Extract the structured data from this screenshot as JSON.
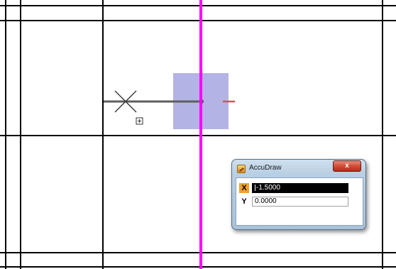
{
  "viewport": {
    "background": "#ffffff",
    "grid_line_color": "#000000",
    "active_axis_color": "#ff00ff",
    "compass_fill": "#b3b3e6",
    "compass_x_tick_color": "#e05050",
    "compass_y_tick_color": "#3caa3c"
  },
  "accudraw": {
    "title": "AccuDraw",
    "close_label": "x",
    "app_icon": "accudraw-app-icon",
    "x_label": "X",
    "x_value": "-1.5000",
    "y_label": "Y",
    "y_value": "0.0000",
    "active_field": "X",
    "active_color": "#f2a12b"
  }
}
